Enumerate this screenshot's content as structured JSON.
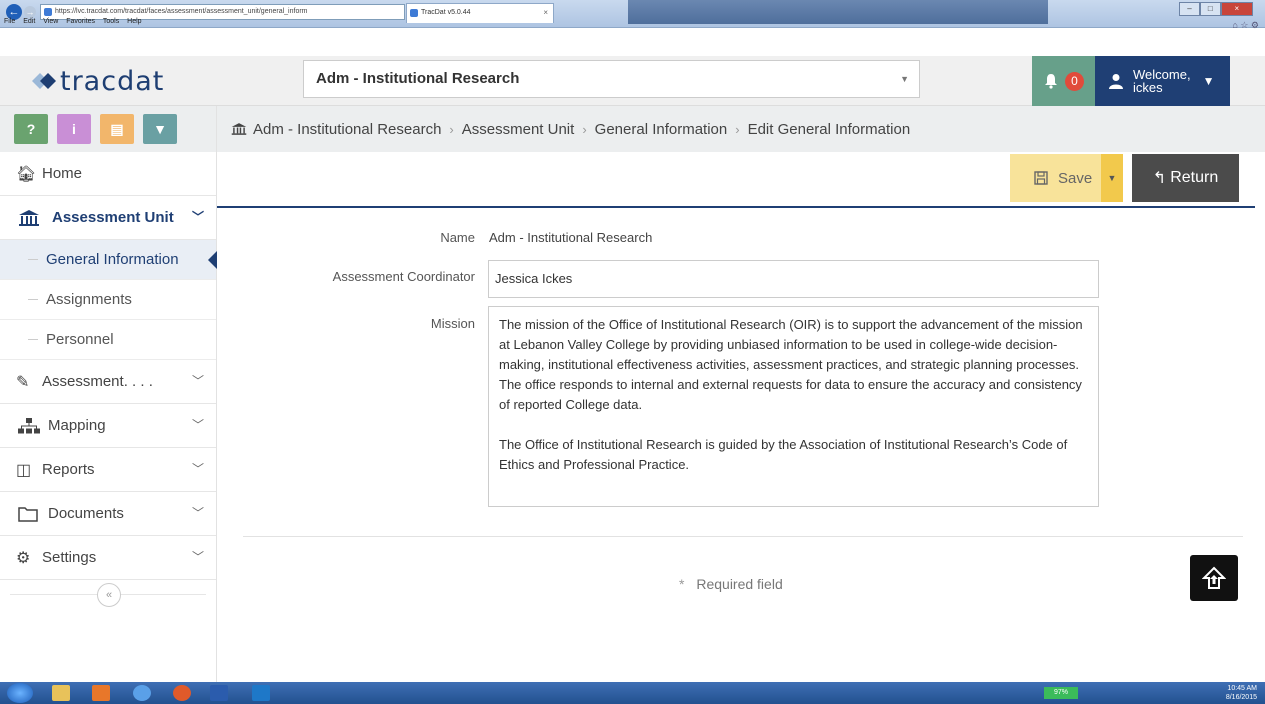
{
  "browser": {
    "address": "https://lvc.tracdat.com/tracdat/faces/assessment/assessment_unit/general_inform",
    "tab_title": "TracDat v5.0.44",
    "menu": [
      "File",
      "Edit",
      "View",
      "Favorites",
      "Tools",
      "Help"
    ]
  },
  "header": {
    "logo_text": "tracdat",
    "unit_selected": "Adm - Institutional Research",
    "notification_count": "0",
    "welcome_label": "Welcome,",
    "user_name": "ickes"
  },
  "quick_buttons": [
    {
      "label": "?",
      "color": "#6aa36f"
    },
    {
      "label": "i",
      "color": "#c98fd6"
    },
    {
      "label": "▤",
      "color": "#f2b66b"
    },
    {
      "label": "▼",
      "color": "#6aa0a3"
    }
  ],
  "sidebar": {
    "home": "Home",
    "assessment_unit": "Assessment Unit",
    "sub_items": [
      "General Information",
      "Assignments",
      "Personnel"
    ],
    "assessment": "Assessment. . . .",
    "mapping": "Mapping",
    "reports": "Reports",
    "documents": "Documents",
    "settings": "Settings",
    "collapse_label": "«"
  },
  "breadcrumb": [
    "Adm - Institutional Research",
    "Assessment Unit",
    "General Information",
    "Edit General Information"
  ],
  "actions": {
    "save_label": "Save",
    "return_label": "Return"
  },
  "form": {
    "name_label": "Name",
    "name_value": "Adm - Institutional Research",
    "coordinator_label": "Assessment Coordinator",
    "coordinator_value": "Jessica Ickes",
    "mission_label": "Mission",
    "mission_p1": "The mission of the Office of Institutional Research (OIR) is to support the advancement of the mission at Lebanon Valley College by providing unbiased information to be used in college-wide decision-making, institutional effectiveness activities, assessment practices, and strategic planning processes.  The office responds to internal and external requests for data to ensure the accuracy and consistency of reported College data.",
    "mission_p2": "The Office of Institutional Research is guided by the Association of Institutional Research’s Code of Ethics and Professional Practice.",
    "required_note": "Required field",
    "required_mark": "*"
  },
  "taskbar": {
    "battery": "97%",
    "time": "10:45 AM",
    "date": "8/16/2015"
  },
  "colors": {
    "brand_navy": "#1f3f74",
    "notif_green": "#67a08a",
    "save_yellow": "#f8e39a",
    "return_dark": "#4b4b4b"
  }
}
